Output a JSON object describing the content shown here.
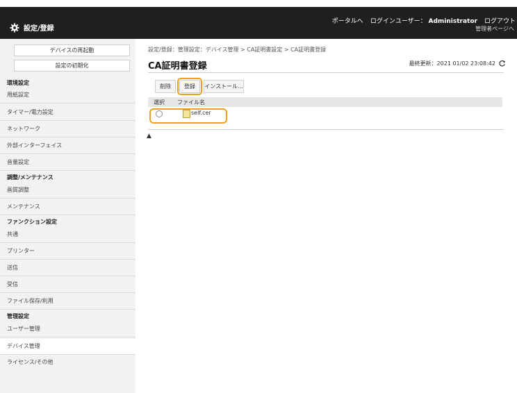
{
  "header": {
    "portal_link": "ポータルへ",
    "login_user_label": "ログインユーザー：",
    "user_name": "Administrator",
    "logout": "ログアウト",
    "app_title": "設定/登録",
    "admin_portal": "管理者ページへ"
  },
  "sidebar": {
    "buttons": [
      "デバイスの再起動",
      "設定の初期化"
    ],
    "sections": [
      {
        "title": "環境設定",
        "items": [
          "用紙設定",
          "タイマー/電力設定",
          "ネットワーク",
          "外部インターフェイス",
          "音量設定"
        ]
      },
      {
        "title": "調整/メンテナンス",
        "items": [
          "画質調整",
          "メンテナンス"
        ]
      },
      {
        "title": "ファンクション設定",
        "items": [
          "共通",
          "プリンター",
          "送信",
          "受信",
          "ファイル保存/利用"
        ]
      },
      {
        "title": "管理設定",
        "items": [
          "ユーザー管理",
          "デバイス管理",
          "ライセンス/その他"
        ]
      }
    ],
    "selected_item": "デバイス管理"
  },
  "main": {
    "breadcrumb": "設定/登録：管理設定：デバイス管理 > CA証明書設定 > CA証明書登録",
    "title": "CA証明書登録",
    "last_updated_label": "最終更新：2021 01/02 23:08:42",
    "toolbar": {
      "delete": "削除",
      "register": "登録",
      "install": "インストール..."
    },
    "table": {
      "headers": [
        "選択",
        "ファイル名"
      ],
      "rows": [
        {
          "file": "self.cer"
        }
      ]
    },
    "top_marker": "▲"
  },
  "colors": {
    "highlight": "#f0a020",
    "header_bg": "#1f1f1f",
    "sidebar_bg": "#f2f2f2"
  }
}
